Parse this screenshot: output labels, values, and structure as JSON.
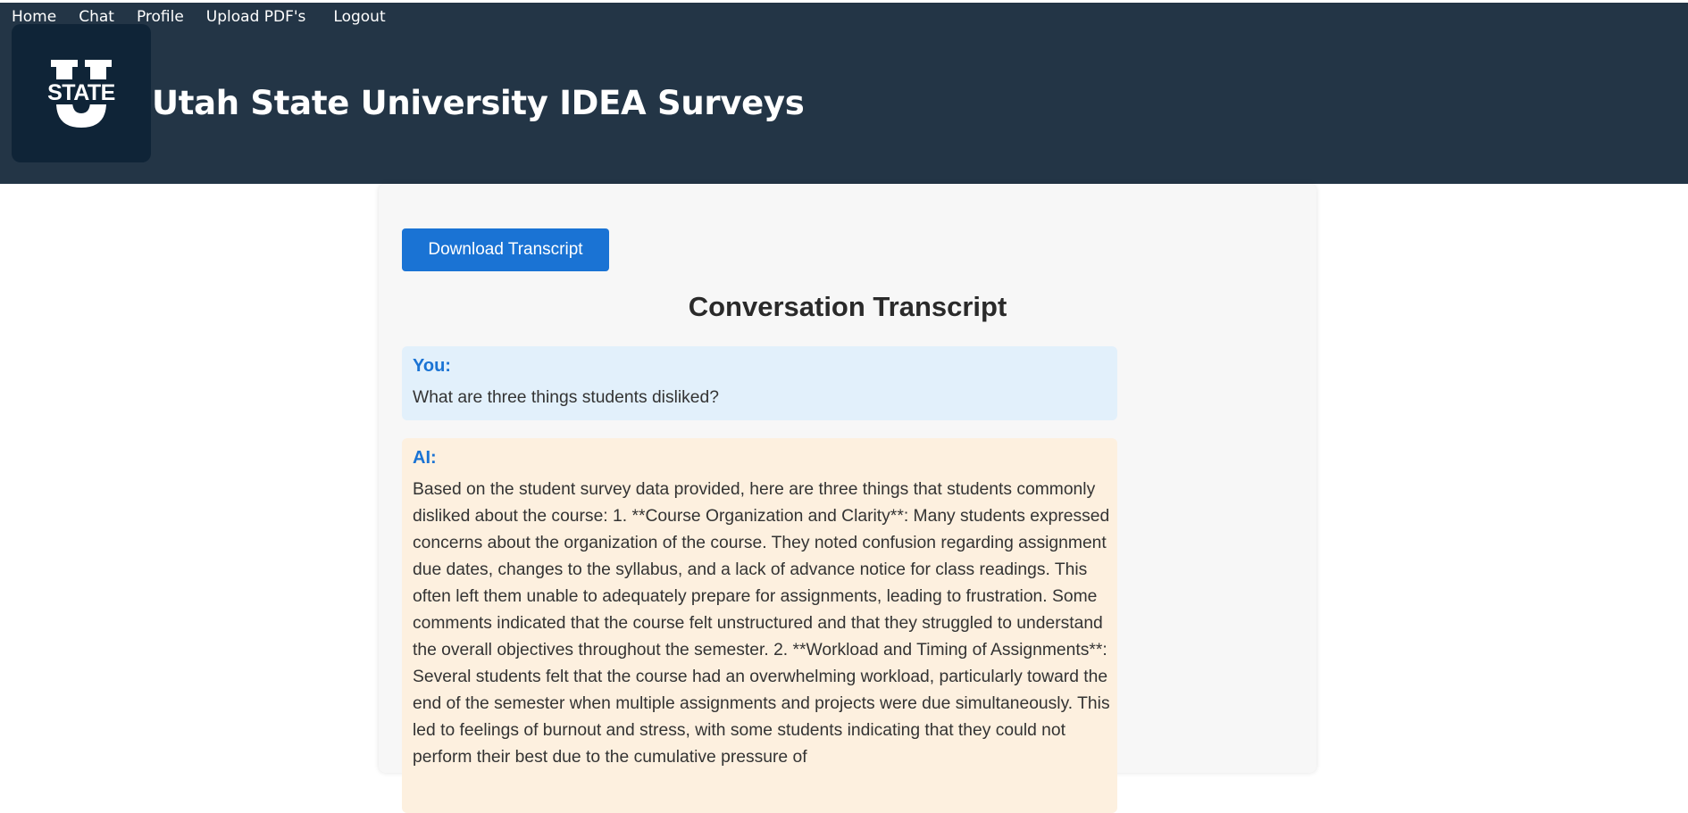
{
  "nav": {
    "items": [
      "Home",
      "Chat",
      "Profile",
      "Upload PDF's",
      "Logout"
    ]
  },
  "header": {
    "title": "Utah State University IDEA Surveys",
    "logo_text": "STATE"
  },
  "main": {
    "download_label": "Download Transcript",
    "transcript_title": "Conversation Transcript",
    "messages": [
      {
        "speaker": "You:",
        "text": "What are three things students disliked?"
      },
      {
        "speaker": "AI:",
        "text": "Based on the student survey data provided, here are three things that students commonly disliked about the course: 1. **Course Organization and Clarity**: Many students expressed concerns about the organization of the course. They noted confusion regarding assignment due dates, changes to the syllabus, and a lack of advance notice for class readings. This often left them unable to adequately prepare for assignments, leading to frustration. Some comments indicated that the course felt unstructured and that they struggled to understand the overall objectives throughout the semester. 2. **Workload and Timing of Assignments**: Several students felt that the course had an overwhelming workload, particularly toward the end of the semester when multiple assignments and projects were due simultaneously. This led to feelings of burnout and stress, with some students indicating that they could not perform their best due to the cumulative pressure of"
      }
    ]
  },
  "colors": {
    "header_bg": "#233546",
    "accent": "#1a73d4",
    "user_bubble": "#e2f0fb",
    "ai_bubble": "#fdf0df"
  }
}
